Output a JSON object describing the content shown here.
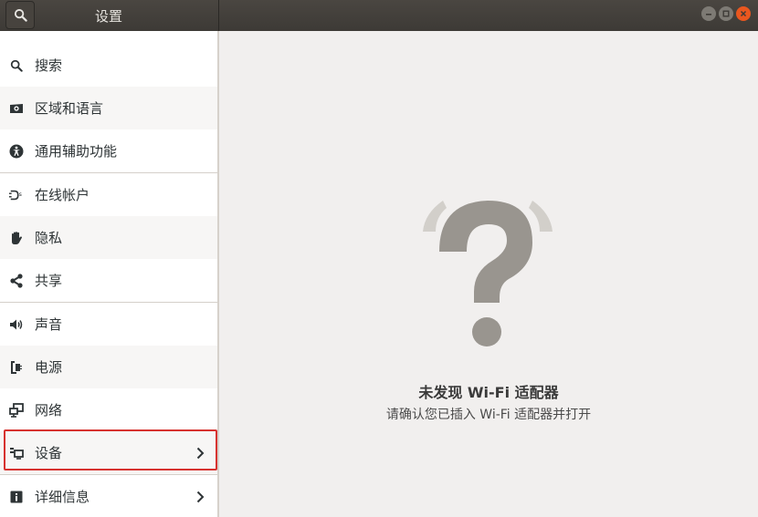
{
  "window": {
    "title": "设置"
  },
  "sidebar": {
    "items": [
      {
        "label": "搜索",
        "icon": "search-icon"
      },
      {
        "label": "区域和语言",
        "icon": "camera-icon"
      },
      {
        "label": "通用辅助功能",
        "icon": "accessibility-icon"
      },
      {
        "label": "在线帐户",
        "icon": "online-accounts-icon"
      },
      {
        "label": "隐私",
        "icon": "hand-icon"
      },
      {
        "label": "共享",
        "icon": "share-icon"
      },
      {
        "label": "声音",
        "icon": "speaker-icon"
      },
      {
        "label": "电源",
        "icon": "power-plug-icon"
      },
      {
        "label": "网络",
        "icon": "network-icon"
      },
      {
        "label": "设备",
        "icon": "devices-icon",
        "selected": true
      },
      {
        "label": "详细信息",
        "icon": "info-icon"
      }
    ]
  },
  "main": {
    "title": "未发现 Wi-Fi 适配器",
    "subtitle": "请确认您已插入 Wi-Fi 适配器并打开"
  },
  "colors": {
    "accent": "#d7322f",
    "header": "#3d3a36",
    "close": "#e9571f"
  }
}
